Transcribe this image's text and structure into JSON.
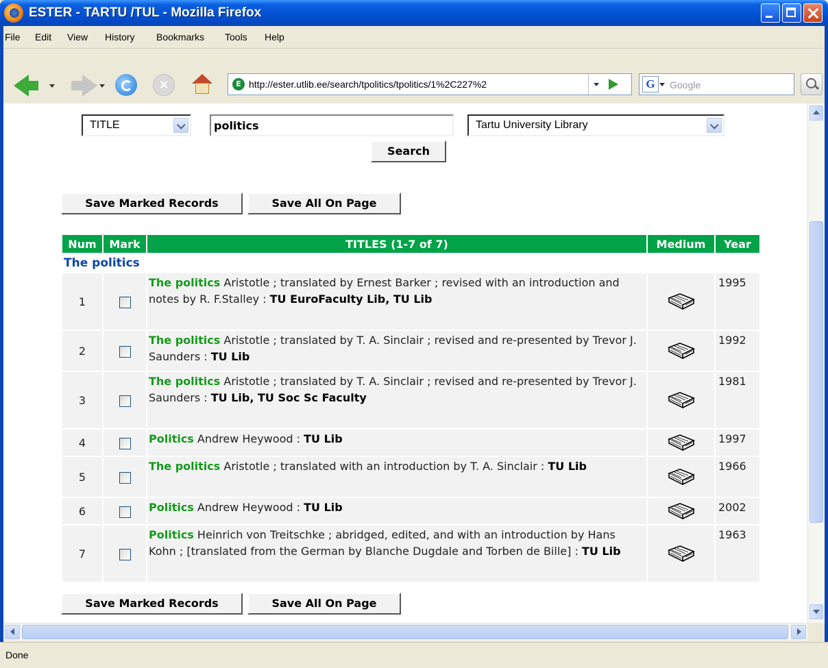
{
  "window": {
    "title": "ESTER - TARTU /TUL - Mozilla Firefox"
  },
  "menu": [
    "File",
    "Edit",
    "View",
    "History",
    "Bookmarks",
    "Tools",
    "Help"
  ],
  "nav": {
    "url": "http://ester.utlib.ee/search/tpolitics/tpolitics/1%2C227%2",
    "search_placeholder": "Google"
  },
  "search": {
    "field": "TITLE",
    "query": "politics",
    "library": "Tartu University Library",
    "button": "Search"
  },
  "actions": {
    "save_marked": "Save Marked Records",
    "save_all": "Save All On Page"
  },
  "table": {
    "headers": {
      "num": "Num",
      "mark": "Mark",
      "titles": "TITLES (1-7 of 7)",
      "medium": "Medium",
      "year": "Year"
    },
    "group": "The politics",
    "rows": [
      {
        "num": "1",
        "title": "The politics",
        "desc": " Aristotle ; translated by Ernest Barker ; revised with an introduction and notes by R. F.Stalley : ",
        "loc": "TU EuroFaculty Lib, TU Lib",
        "year": "1995"
      },
      {
        "num": "2",
        "title": "The politics",
        "desc": " Aristotle ; translated by T. A. Sinclair ; revised and re-presented by Trevor J. Saunders : ",
        "loc": "TU Lib",
        "year": "1992"
      },
      {
        "num": "3",
        "title": "The politics",
        "desc": " Aristotle ; translated by T. A. Sinclair ; revised and re-presented by Trevor J. Saunders : ",
        "loc": "TU Lib, TU Soc Sc Faculty",
        "year": "1981"
      },
      {
        "num": "4",
        "title": "Politics",
        "desc": " Andrew Heywood : ",
        "loc": "TU Lib",
        "year": "1997"
      },
      {
        "num": "5",
        "title": "The politics",
        "desc": " Aristotle ; translated with an introduction by T. A. Sinclair : ",
        "loc": "TU Lib",
        "year": "1966"
      },
      {
        "num": "6",
        "title": "Politics",
        "desc": " Andrew Heywood : ",
        "loc": "TU Lib",
        "year": "2002"
      },
      {
        "num": "7",
        "title": "Politics",
        "desc": " Heinrich von Treitschke ; abridged, edited, and with an introduction by Hans Kohn ; [translated from the German by Blanche Dugdale and Torben de Bille] : ",
        "loc": "TU Lib",
        "year": "1963"
      }
    ]
  },
  "status": {
    "text": "Done"
  },
  "icons": {
    "medium": "book-icon"
  }
}
